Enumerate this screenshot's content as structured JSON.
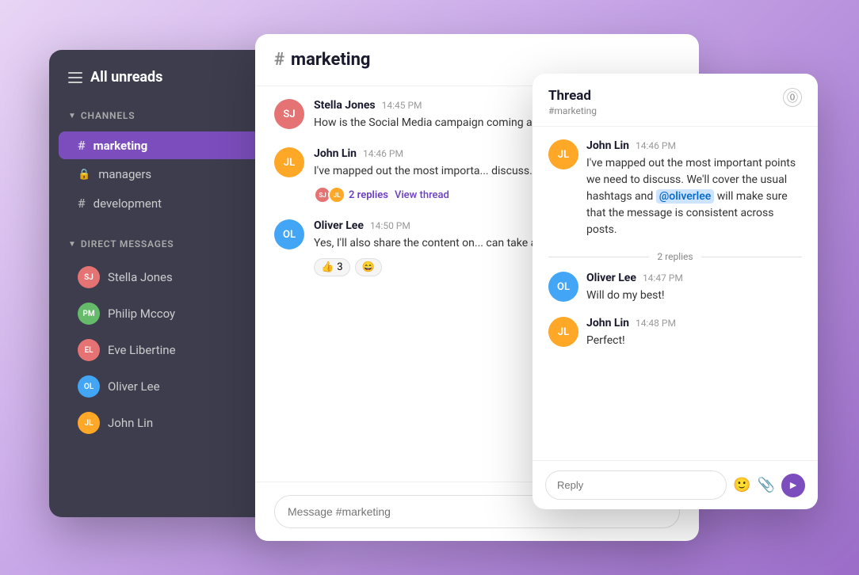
{
  "sidebar": {
    "header": "All unreads",
    "channels_section": "CHANNELS",
    "channels": [
      {
        "name": "marketing",
        "type": "hash",
        "active": true
      },
      {
        "name": "managers",
        "type": "lock"
      },
      {
        "name": "development",
        "type": "hash"
      }
    ],
    "dm_section": "DIRECT MESSAGES",
    "dms": [
      {
        "name": "Stella Jones",
        "color": "bg-rose"
      },
      {
        "name": "Philip Mccoy",
        "color": "bg-green"
      },
      {
        "name": "Eve Libertine",
        "color": "bg-rose"
      },
      {
        "name": "Oliver Lee",
        "color": "bg-blue"
      },
      {
        "name": "John Lin",
        "color": "bg-orange"
      }
    ]
  },
  "chat": {
    "channel": "marketing",
    "messages": [
      {
        "author": "Stella Jones",
        "time": "14:45 PM",
        "text": "How is the Social Media campaign coming along?",
        "avatar_color": "bg-rose",
        "initials": "SJ"
      },
      {
        "author": "John Lin",
        "time": "14:46 PM",
        "text": "I've mapped out the most important points we need to discuss. We'll cover the usual has...",
        "full_text": "I've mapped out the most important points we need to discuss. We'll cover the usual hashtags and will make sure that the message...",
        "avatar_color": "bg-orange",
        "initials": "JL",
        "has_thread": true,
        "thread_reply_count": 2,
        "view_thread": "View thread"
      },
      {
        "author": "Oliver Lee",
        "time": "14:50 PM",
        "text": "Yes, I'll also share the content on... can take a look and make sure ev...",
        "avatar_color": "bg-blue",
        "initials": "OL",
        "has_reactions": true,
        "reactions": [
          {
            "emoji": "👍",
            "count": 3
          },
          {
            "emoji": "😄",
            "count": null
          }
        ]
      }
    ],
    "input_placeholder": "Message #marketing"
  },
  "thread": {
    "title": "Thread",
    "channel": "#marketing",
    "close_label": "×",
    "messages": [
      {
        "author": "John Lin",
        "time": "14:46 PM",
        "text": "I've mapped out the most important points we need to discuss. We'll cover the usual hashtags and",
        "mention": "@oliverlee",
        "text_after": "will make sure that the message is consistent across posts.",
        "avatar_color": "bg-orange",
        "initials": "JL"
      }
    ],
    "replies_divider": "2 replies",
    "replies": [
      {
        "author": "Oliver Lee",
        "time": "14:47 PM",
        "text": "Will do my best!",
        "avatar_color": "bg-blue",
        "initials": "OL"
      },
      {
        "author": "John Lin",
        "time": "14:48 PM",
        "text": "Perfect!",
        "avatar_color": "bg-orange",
        "initials": "JL"
      }
    ],
    "input_placeholder": "Reply"
  }
}
